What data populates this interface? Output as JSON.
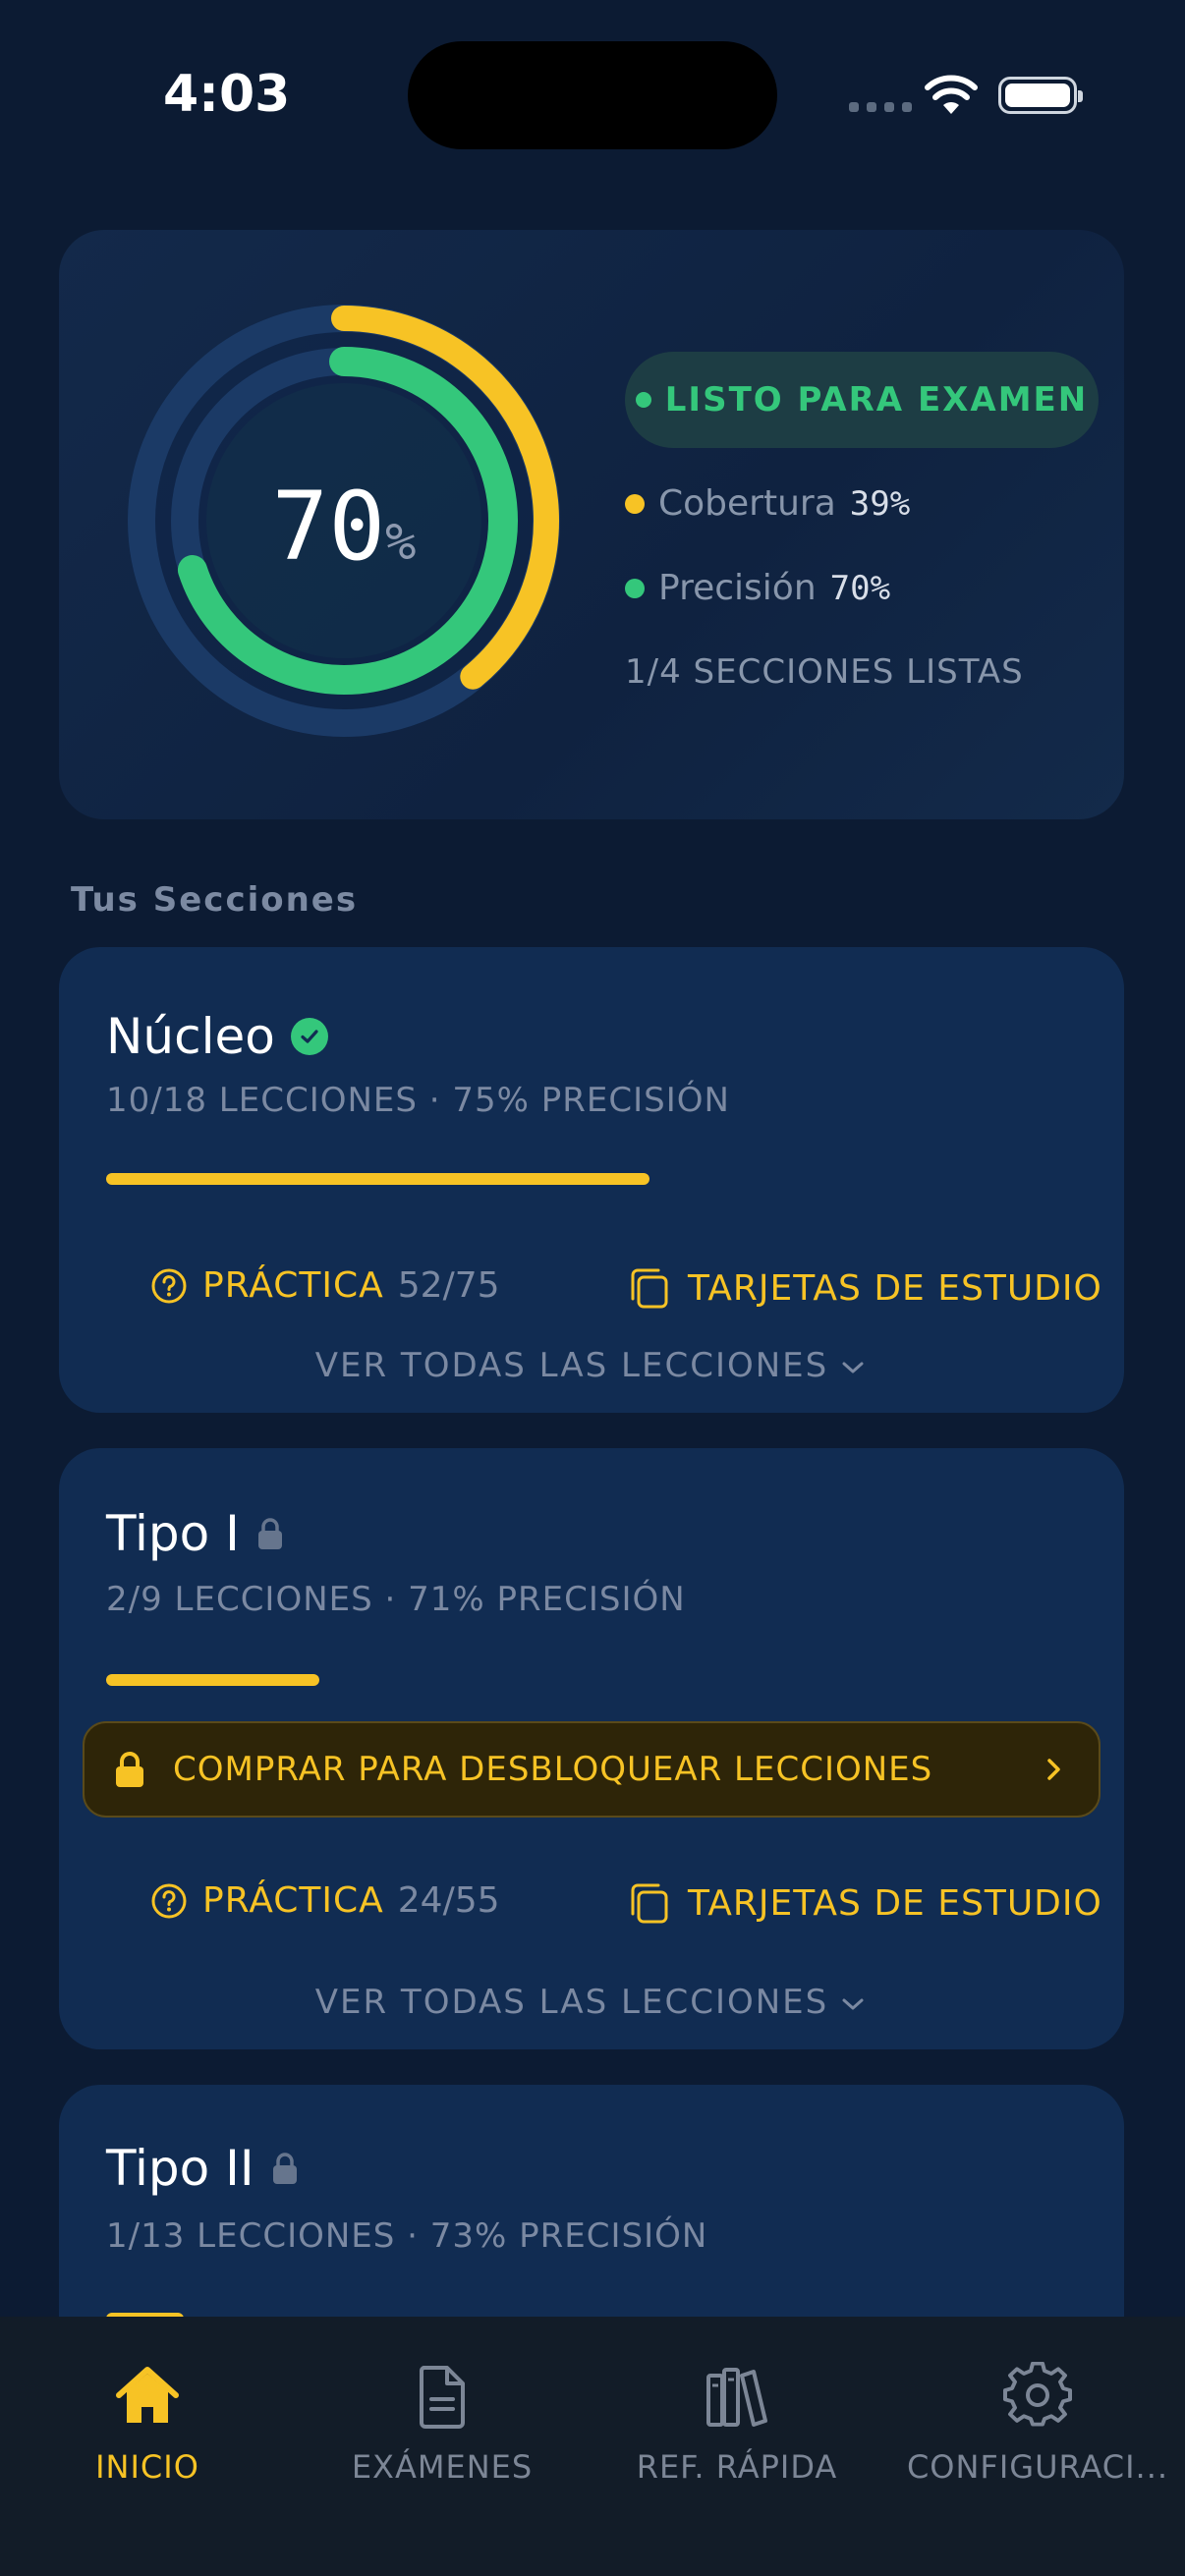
{
  "status_bar": {
    "time": "4:03"
  },
  "summary": {
    "readiness_pct": "70",
    "pct_symbol": "%",
    "ready_label": "LISTO PARA EXAMEN",
    "coverage_label": "Cobertura",
    "coverage_value": "39%",
    "accuracy_label": "Precisión",
    "accuracy_value": "70%",
    "sections_ready": "1/4 SECCIONES LISTAS",
    "coverage_fraction": 0.39,
    "accuracy_fraction": 0.7,
    "colors": {
      "coverage": "#f7c325",
      "accuracy": "#34c77b",
      "track": "#1b3a66"
    }
  },
  "sections_heading": "Tus Secciones",
  "sections": [
    {
      "title": "Núcleo",
      "status": "complete",
      "subtitle": "10/18 LECCIONES · 75% PRECISIÓN",
      "progress": 0.56,
      "practice_label": "PRÁCTICA",
      "practice_count": "52/75",
      "flashcards_label": "TARJETAS DE ESTUDIO",
      "view_all_label": "VER TODAS LAS LECCIONES"
    },
    {
      "title": "Tipo I",
      "status": "locked",
      "subtitle": "2/9 LECCIONES · 71% PRECISIÓN",
      "progress": 0.22,
      "unlock_label": "COMPRAR PARA DESBLOQUEAR LECCIONES",
      "practice_label": "PRÁCTICA",
      "practice_count": "24/55",
      "flashcards_label": "TARJETAS DE ESTUDIO",
      "view_all_label": "VER TODAS LAS LECCIONES"
    },
    {
      "title": "Tipo II",
      "status": "locked",
      "subtitle": "1/13 LECCIONES · 73% PRECISIÓN",
      "progress": 0.08
    }
  ],
  "tabs": [
    {
      "label": "INICIO",
      "icon": "home-icon",
      "active": true
    },
    {
      "label": "EXÁMENES",
      "icon": "document-icon",
      "active": false
    },
    {
      "label": "REF. RÁPIDA",
      "icon": "books-icon",
      "active": false
    },
    {
      "label": "CONFIGURACI...",
      "icon": "gear-icon",
      "active": false
    }
  ],
  "colors": {
    "accent": "#f7c325",
    "success": "#34c77b",
    "background": "#0c1b33",
    "card": "#112c52"
  }
}
